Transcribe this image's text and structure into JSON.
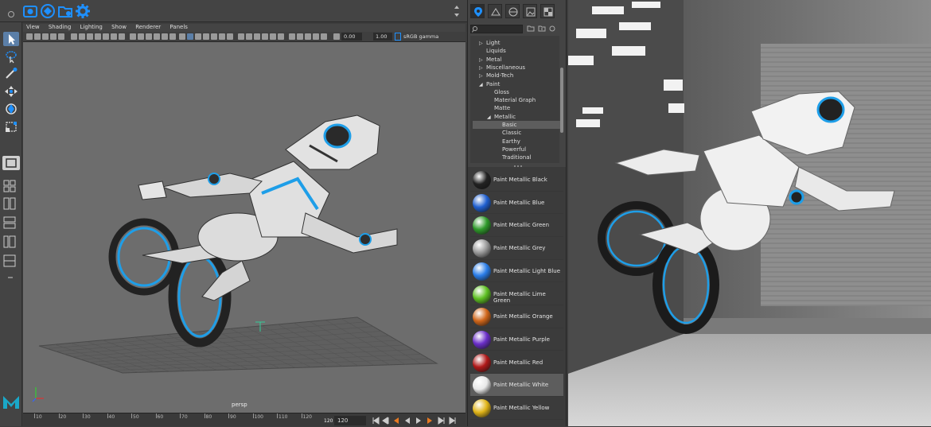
{
  "colors": {
    "accent": "#1e90ff",
    "panel": "#444444",
    "viewport": "#6d6d6d",
    "highlight": "#5d5d5d"
  },
  "viewport": {
    "menu": [
      "View",
      "Shading",
      "Lighting",
      "Show",
      "Renderer",
      "Panels"
    ],
    "exposure": "0.00",
    "gamma": "1.00",
    "color_space": "sRGB gamma",
    "camera_label": "persp"
  },
  "timeline": {
    "ticks": [
      "10",
      "20",
      "30",
      "40",
      "50",
      "60",
      "70",
      "80",
      "90",
      "100",
      "110",
      "120"
    ],
    "current_frame": "120",
    "end_frame": "120"
  },
  "browser": {
    "search_placeholder": "",
    "tree": [
      {
        "label": "Light",
        "arrow": "▷",
        "level": 0
      },
      {
        "label": "Liquids",
        "arrow": "",
        "level": 0
      },
      {
        "label": "Metal",
        "arrow": "▷",
        "level": 0
      },
      {
        "label": "Miscellaneous",
        "arrow": "▷",
        "level": 0
      },
      {
        "label": "Mold-Tech",
        "arrow": "▷",
        "level": 0
      },
      {
        "label": "Paint",
        "arrow": "◢",
        "level": 0
      },
      {
        "label": "Gloss",
        "arrow": "",
        "level": 1
      },
      {
        "label": "Material Graph",
        "arrow": "",
        "level": 1
      },
      {
        "label": "Matte",
        "arrow": "",
        "level": 1
      },
      {
        "label": "Metallic",
        "arrow": "◢",
        "level": 1
      },
      {
        "label": "Basic",
        "arrow": "",
        "level": 2,
        "selected": true
      },
      {
        "label": "Classic",
        "arrow": "",
        "level": 2
      },
      {
        "label": "Earthy",
        "arrow": "",
        "level": 2
      },
      {
        "label": "Powerful",
        "arrow": "",
        "level": 2
      },
      {
        "label": "Traditional",
        "arrow": "",
        "level": 2
      }
    ],
    "materials": [
      {
        "label": "Paint Metallic Black",
        "color": "#222222"
      },
      {
        "label": "Paint Metallic Blue",
        "color": "#1f5fd0"
      },
      {
        "label": "Paint Metallic Green",
        "color": "#2e9a2a"
      },
      {
        "label": "Paint Metallic Grey",
        "color": "#9a9a9a"
      },
      {
        "label": "Paint Metallic Light Blue",
        "color": "#2a7de8"
      },
      {
        "label": "Paint Metallic Lime Green",
        "color": "#5ec022"
      },
      {
        "label": "Paint Metallic Orange",
        "color": "#d0661a"
      },
      {
        "label": "Paint Metallic Purple",
        "color": "#6a2ec8"
      },
      {
        "label": "Paint Metallic Red",
        "color": "#b01818"
      },
      {
        "label": "Paint Metallic White",
        "color": "#e8e8e8",
        "selected": true
      },
      {
        "label": "Paint Metallic Yellow",
        "color": "#e0b418"
      }
    ]
  }
}
